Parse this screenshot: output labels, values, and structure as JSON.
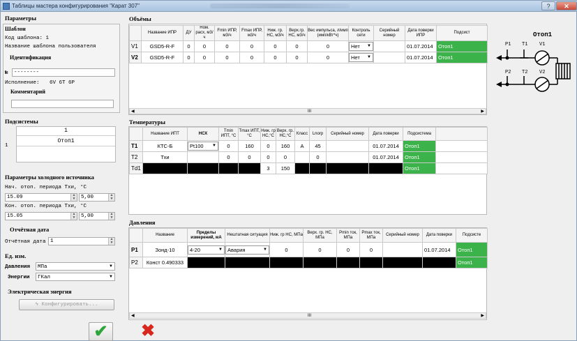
{
  "window": {
    "title": "Таблицы мастера конфигурирования \"Карат 307\"",
    "help": "?",
    "close": "✕"
  },
  "left": {
    "params_header": "Параметры",
    "template_header": "Шаблон",
    "template_code": "Код шаблона:  1",
    "template_name": "Название шаблона пользователя",
    "ident_header": "Идентификация",
    "serial_label": "№",
    "serial_value": "--------",
    "exec_label": "Исполнение:",
    "exec_value": "6V 6T 6P",
    "comment_header": "Комментарий",
    "comment_value": "",
    "subsys_header": "Подсистемы",
    "subsys_col": "1",
    "subsys_row_num": "1",
    "subsys_row_val": "Отоп1",
    "cold_header": "Параметры холодного источника",
    "start_label": "Нач. отоп. периода Тхи, °C",
    "start_date": "15.09",
    "start_temp": "5,00",
    "end_label": "Кон. отоп. периода Тхи, °C",
    "end_date": "15.05",
    "end_temp": "5,00",
    "report_header": "Отчётная дата",
    "report_label": "Отчётная дата",
    "report_value": "1",
    "units_header": "Ед. изм.",
    "pressure_label": "Давления",
    "pressure_value": "МПа",
    "energy_label": "Энергии",
    "energy_value": "ГКал",
    "elec_header": "Электрическая энергия",
    "configure_btn": "Конфигурировать..."
  },
  "volumes": {
    "header": "Объёмы",
    "cols": [
      "Название ИПР",
      "ДУ",
      "Ном. расх, м3/ч",
      "Fmin ИПР, м3/ч",
      "Fmax ИПР, м3/ч",
      "Ниж. гр. НС, м3/ч",
      "Верх.гр. НС, м3/ч",
      "Вес импульса, л/имп (имп/кВт*ч)",
      "Контроль сети",
      "Серийный номер",
      "Дата поверки ИПР",
      "Подсист"
    ],
    "rows": [
      {
        "id": "V1",
        "name": "GSD5-R-F",
        "du": "0",
        "nom": "0",
        "fmin": "0",
        "fmax": "0",
        "low": "0",
        "high": "0",
        "weight": "0",
        "ctrl": "Нет",
        "serial": "",
        "date": "01.07.2014",
        "sub": "Отоп1"
      },
      {
        "id": "V2",
        "name": "GSD5-R-F",
        "du": "0",
        "nom": "0",
        "fmin": "0",
        "fmax": "0",
        "low": "0",
        "high": "0",
        "weight": "0",
        "ctrl": "Нет",
        "serial": "",
        "date": "01.07.2014",
        "sub": "Отоп1"
      }
    ]
  },
  "temps": {
    "header": "Температуры",
    "cols": [
      "Название ИПТ",
      "НСХ",
      "Tmin ИПТ, °C",
      "Tmax ИПТ, °C",
      "Ниж. гр НС,°C",
      "Верх. гр. НС,°C",
      "Класс",
      "Lnorp",
      "Серийный номер",
      "Дата поверки",
      "Подсистема"
    ],
    "rows": [
      {
        "id": "T1",
        "name": "КТС-Б",
        "nsx": "Pt100",
        "tmin": "0",
        "tmax": "160",
        "low": "0",
        "high": "160",
        "cls": "A",
        "lnorp": "45",
        "serial": "",
        "date": "01.07.2014",
        "sub": "Отоп1"
      },
      {
        "id": "T2",
        "name": "Тхи",
        "nsx": "",
        "tmin": "0",
        "tmax": "0",
        "low": "0",
        "high": "0",
        "cls": "",
        "lnorp": "0",
        "serial": "",
        "date": "01.07.2014",
        "sub": "Отоп1"
      },
      {
        "id": "Td1",
        "name": "",
        "nsx": "",
        "tmin": "",
        "tmax": "",
        "low": "3",
        "high": "150",
        "cls": "",
        "lnorp": "",
        "serial": "",
        "date": "",
        "sub": "Отоп1"
      }
    ]
  },
  "press": {
    "header": "Давления",
    "cols": [
      "Название",
      "Пределы измерений, мА",
      "Нештатная ситуация",
      "Ниж. гр НС, МПа",
      "Верх. гр. НС, МПа",
      "Pmin ток, МПа",
      "Pmax ток, МПа",
      "Серийный номер",
      "Дата поверки",
      "Подсисте"
    ],
    "rows": [
      {
        "id": "P1",
        "name": "Зонд-10",
        "range": "4-20",
        "sit": "Авария",
        "low": "0",
        "high": "0",
        "pmin": "0",
        "pmax": "0",
        "serial": "",
        "date": "01.07.2014",
        "sub": "Отоп1"
      },
      {
        "id": "P2",
        "name": "Конст 0.490333",
        "range": "",
        "sit": "",
        "low": "",
        "high": "",
        "pmin": "",
        "pmax": "",
        "serial": "",
        "date": "",
        "sub": "Отоп1"
      }
    ]
  },
  "scheme": {
    "title": "Отоп1",
    "p1": "P1",
    "t1": "T1",
    "v1": "V1",
    "p2": "P2",
    "t2": "T2",
    "v2": "V2"
  },
  "footer": {
    "ok": "✔",
    "cancel": "✖"
  }
}
